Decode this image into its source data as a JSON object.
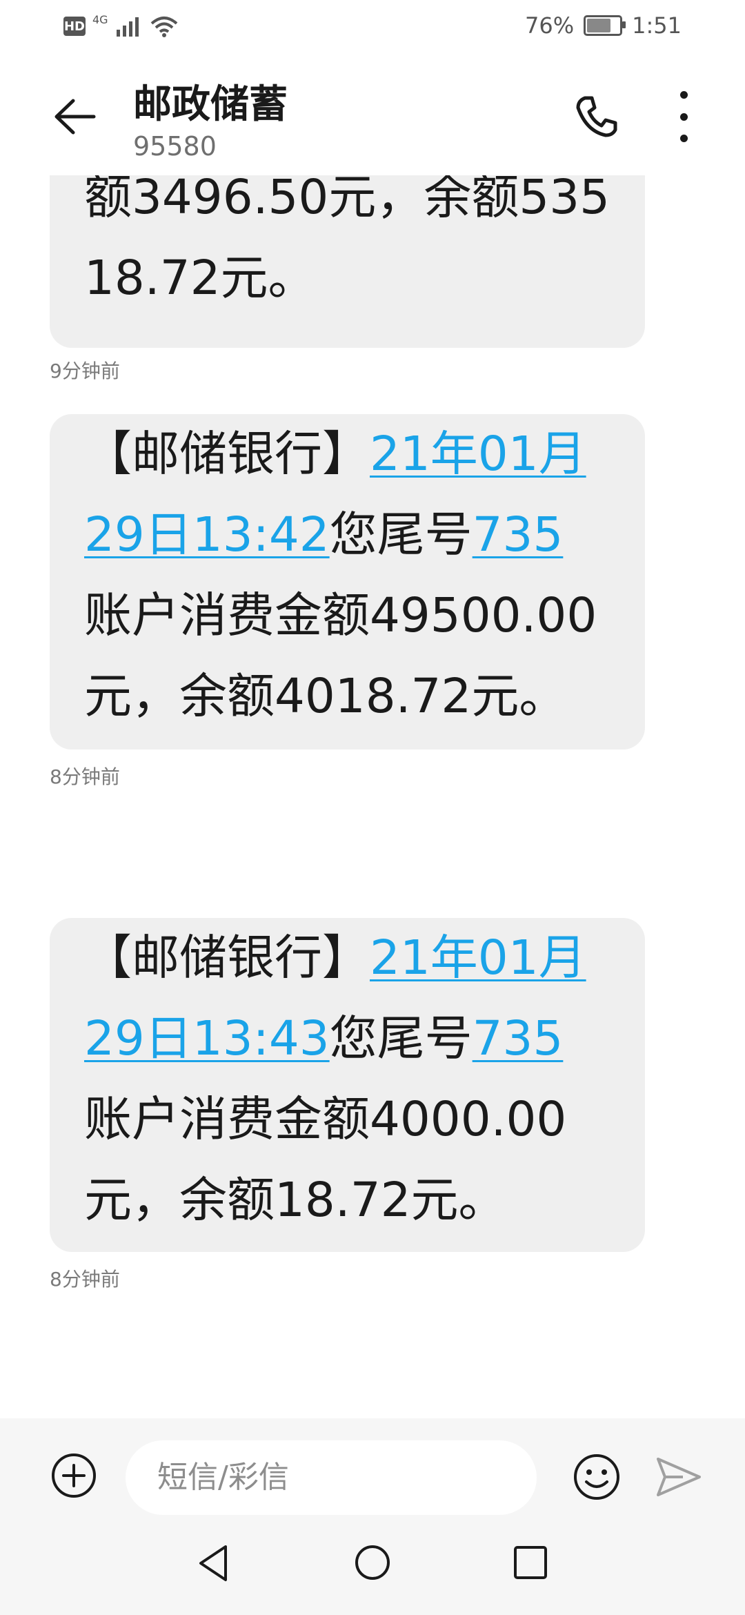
{
  "status_bar": {
    "network_badge": "HD",
    "network_type": "4G",
    "battery_percent": "76%",
    "battery_level": 0.76,
    "time": "1:51"
  },
  "header": {
    "title": "邮政储蓄",
    "subtitle": "95580",
    "icons": [
      "back-arrow-icon",
      "phone-icon",
      "more-vertical-icon"
    ]
  },
  "messages": [
    {
      "parts": [
        {
          "text": "额3496.50元，余额"
        },
        {
          "text": "53518.72元。"
        }
      ],
      "time": "9分钟前"
    },
    {
      "parts": [
        {
          "text": "【邮储银行】"
        },
        {
          "text": "21年01月29日13:42",
          "link": true
        },
        {
          "text": "您尾号"
        },
        {
          "text": "735",
          "link": true
        },
        {
          "text": "账户消费金额49500.00元，余额4018.72元。"
        }
      ],
      "time": "8分钟前"
    },
    {
      "parts": [
        {
          "text": "【邮储银行】"
        },
        {
          "text": "21年01月29日13:43",
          "link": true
        },
        {
          "text": "您尾号"
        },
        {
          "text": "735",
          "link": true
        },
        {
          "text": "账户消费金额4000.00元，余额18.72元。"
        }
      ],
      "time": "8分钟前"
    }
  ],
  "input_bar": {
    "placeholder": "短信/彩信",
    "icons": [
      "add-icon",
      "emoji-icon",
      "send-icon"
    ]
  },
  "nav_bar": {
    "icons": [
      "nav-back-icon",
      "nav-home-icon",
      "nav-recent-icon"
    ]
  },
  "colors": {
    "link": "#1aa3e8",
    "bubble": "#efefef",
    "bar_background": "#f6f6f6"
  }
}
